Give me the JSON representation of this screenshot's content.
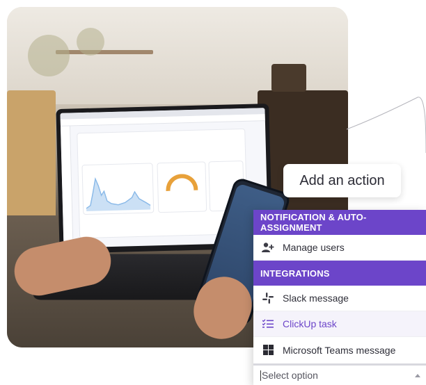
{
  "action_pill": {
    "label": "Add an action"
  },
  "menu": {
    "sections": [
      {
        "title": "NOTIFICATION & AUTO-ASSIGNMENT",
        "items": [
          {
            "label": "Manage users",
            "icon": "add-user-icon"
          }
        ]
      },
      {
        "title": "INTEGRATIONS",
        "items": [
          {
            "label": "Slack message",
            "icon": "slack-icon"
          },
          {
            "label": "ClickUp task",
            "icon": "task-list-icon"
          },
          {
            "label": "Microsoft Teams message",
            "icon": "windows-logo-icon"
          }
        ]
      }
    ],
    "select_placeholder": "Select option"
  },
  "colors": {
    "accent": "#6c45c9",
    "highlight_bg": "#f5f3fb",
    "text": "#2e2e38"
  }
}
